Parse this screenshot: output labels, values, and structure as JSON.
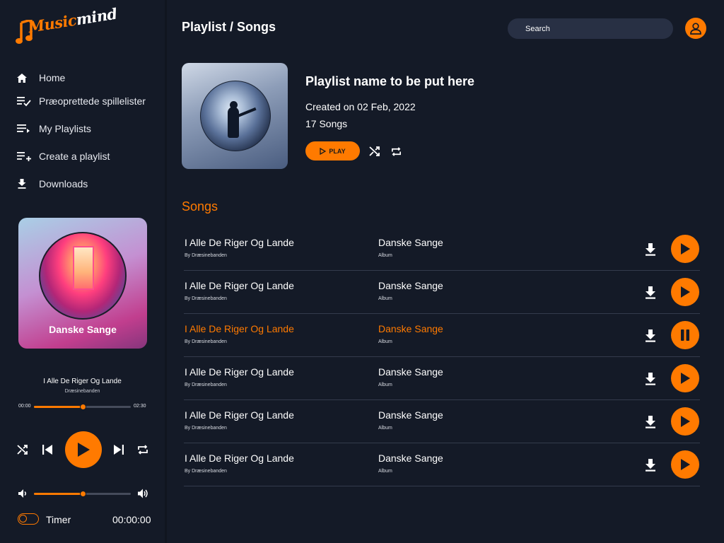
{
  "app": {
    "logo_part1": "Music",
    "logo_part2": "mind",
    "accent_color": "#ff7a00",
    "background_color": "#141a27"
  },
  "sidebar": {
    "items": [
      {
        "label": "Home",
        "icon": "home-icon"
      },
      {
        "label": "Præoprettede spillelister",
        "icon": "playlist-check-icon"
      },
      {
        "label": "My Playlists",
        "icon": "playlist-icon"
      },
      {
        "label": "Create a playlist",
        "icon": "playlist-add-icon"
      },
      {
        "label": "Downloads",
        "icon": "download-icon"
      }
    ],
    "album_card_title": "Danske Sange"
  },
  "player": {
    "title": "I Alle De Riger Og Lande",
    "artist": "Dræsinebanden",
    "time_elapsed": "00:00",
    "time_total": "02:30",
    "progress_fraction": 0.5,
    "volume_fraction": 0.5,
    "controls": [
      "shuffle-icon",
      "previous-icon",
      "play-icon",
      "next-icon",
      "repeat-icon"
    ],
    "timer_label": "Timer",
    "timer_value": "00:00:00",
    "timer_enabled": false
  },
  "header": {
    "breadcrumb": "Playlist / Songs",
    "search_placeholder": "Search"
  },
  "playlist": {
    "name": "Playlist name to be put here",
    "created": "Created on 02 Feb, 2022",
    "count": "17 Songs",
    "play_label": "PLAY"
  },
  "songs": {
    "heading": "Songs",
    "rows": [
      {
        "title": "I Alle De Riger Og Lande",
        "artist": "By Dræsinebanden",
        "album": "Danske Sange",
        "album_label": "Album",
        "state": "play"
      },
      {
        "title": "I Alle De Riger Og Lande",
        "artist": "By Dræsinebanden",
        "album": "Danske Sange",
        "album_label": "Album",
        "state": "play"
      },
      {
        "title": "I Alle De Riger Og Lande",
        "artist": "By Dræsinebanden",
        "album": "Danske Sange",
        "album_label": "Album",
        "state": "pause"
      },
      {
        "title": "I Alle De Riger Og Lande",
        "artist": "By Dræsinebanden",
        "album": "Danske Sange",
        "album_label": "Album",
        "state": "play"
      },
      {
        "title": "I Alle De Riger Og Lande",
        "artist": "By Dræsinebanden",
        "album": "Danske Sange",
        "album_label": "Album",
        "state": "play"
      },
      {
        "title": "I Alle De Riger Og Lande",
        "artist": "By Dræsinebanden",
        "album": "Danske Sange",
        "album_label": "Album",
        "state": "play"
      }
    ]
  }
}
